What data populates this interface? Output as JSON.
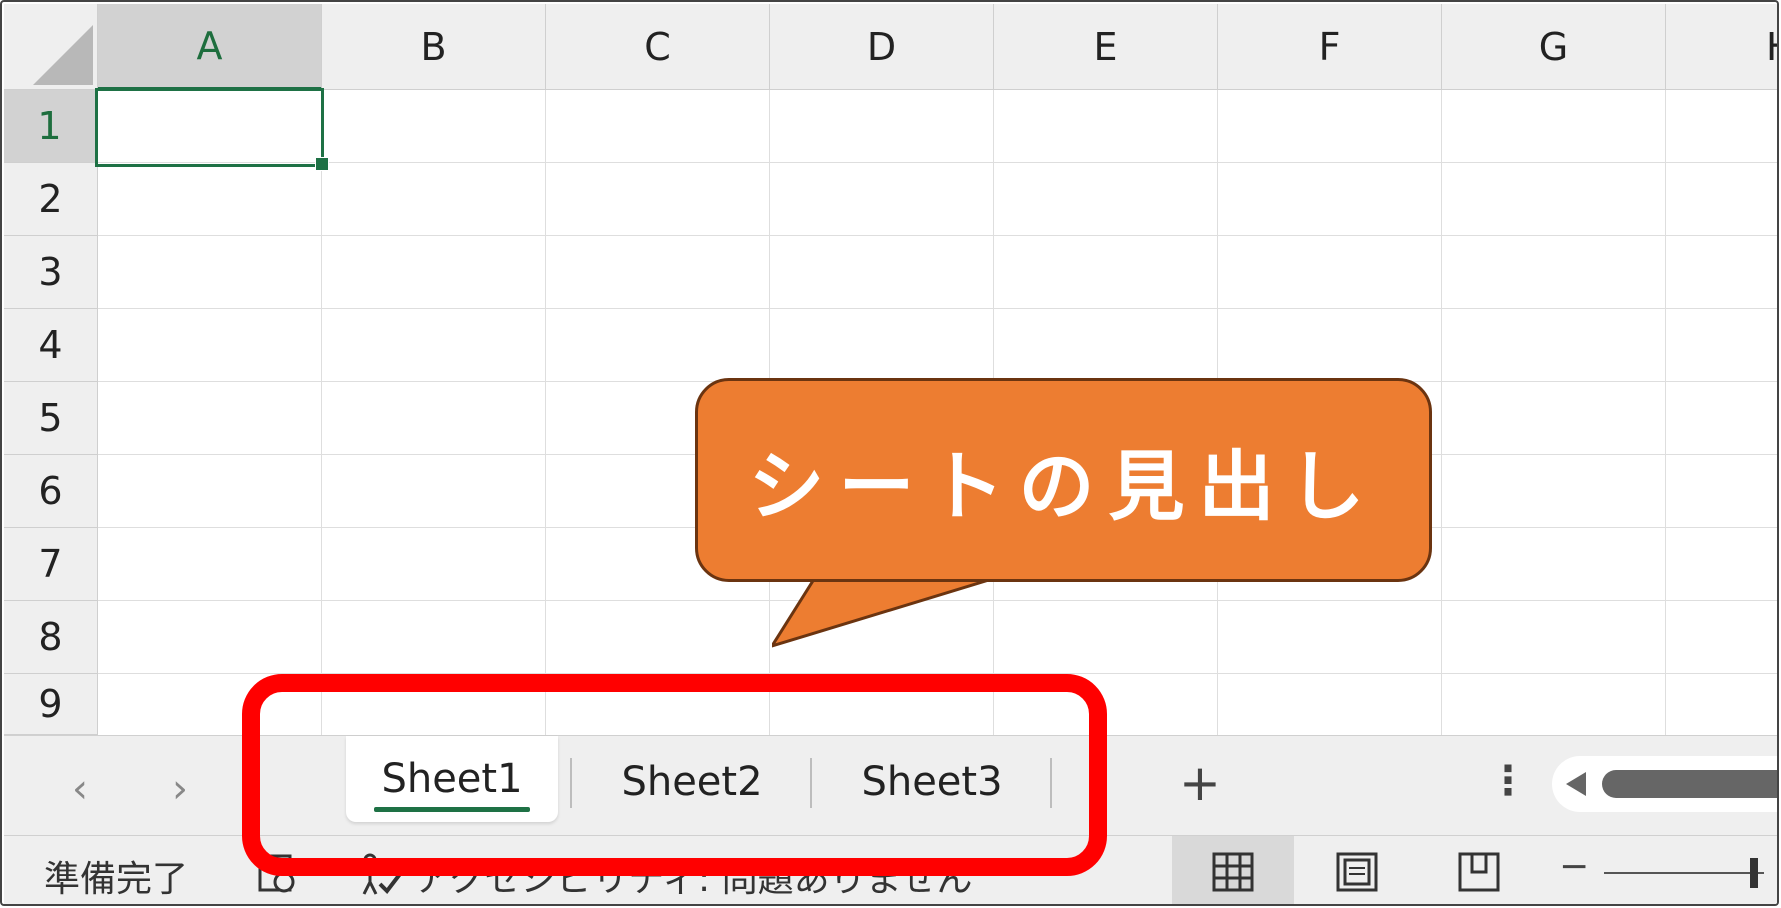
{
  "columns": [
    "A",
    "B",
    "C",
    "D",
    "E",
    "F",
    "G",
    "H"
  ],
  "rows": [
    "1",
    "2",
    "3",
    "4",
    "5",
    "6",
    "7",
    "8",
    "9"
  ],
  "active_cell": {
    "column": "A",
    "row": "1"
  },
  "sheet_nav": {
    "prev_icon": "chevron-left-icon",
    "next_icon": "chevron-right-icon",
    "prev": "‹",
    "next": "›"
  },
  "sheets": [
    "Sheet1",
    "Sheet2",
    "Sheet3"
  ],
  "active_sheet": "Sheet1",
  "add_sheet_label": "+",
  "more_label": "⋮",
  "status": {
    "ready": "準備完了",
    "accessibility": "アクセシビリティ: 問題ありません"
  },
  "callout": {
    "text": "シートの見出し",
    "color": "#ed7d31"
  },
  "highlight_color": "#ff0000",
  "accent_color": "#1e7145"
}
